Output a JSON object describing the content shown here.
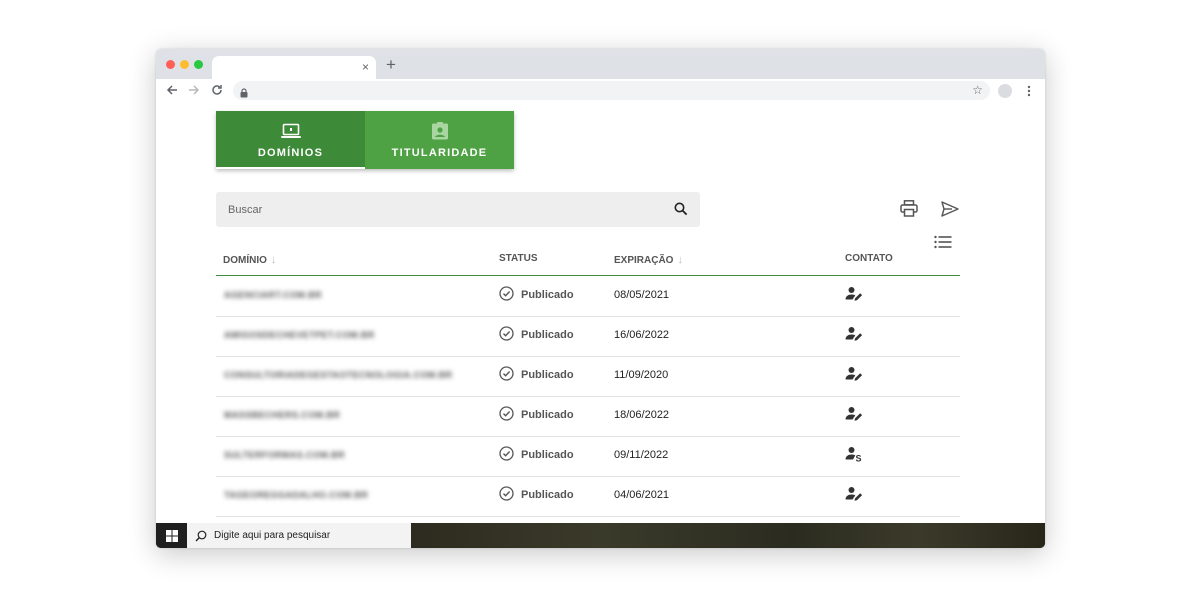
{
  "browser": {
    "tab_close": "×",
    "new_tab": "+",
    "star": "☆"
  },
  "tabs": [
    {
      "label": "DOMÍNIOS",
      "icon": "laptop-icon",
      "active": true
    },
    {
      "label": "TITULARIDADE",
      "icon": "clipboard-account-icon",
      "active": false
    }
  ],
  "search": {
    "placeholder": "Buscar"
  },
  "table": {
    "headers": {
      "domain": "DOMÍNIO",
      "status": "STATUS",
      "expiration": "EXPIRAÇÃO",
      "contact": "CONTATO"
    },
    "rows": [
      {
        "domain": "AGENCIART.COM.BR",
        "status": "Publicado",
        "expiration": "08/05/2021",
        "contact_icon": "account-edit-icon"
      },
      {
        "domain": "AMIGOSDECHEVETPET.COM.BR",
        "status": "Publicado",
        "expiration": "16/06/2022",
        "contact_icon": "account-edit-icon"
      },
      {
        "domain": "CONSULTORIADEGESTAOTECNOLOGIA.COM.BR",
        "status": "Publicado",
        "expiration": "11/09/2020",
        "contact_icon": "account-edit-icon"
      },
      {
        "domain": "MASSBECHERS.COM.BR",
        "status": "Publicado",
        "expiration": "18/06/2022",
        "contact_icon": "account-edit-icon"
      },
      {
        "domain": "SULTERFORMAS.COM.BR",
        "status": "Publicado",
        "expiration": "09/11/2022",
        "contact_icon": "account-dollar-icon"
      },
      {
        "domain": "TAGEOREGGADALHO.COM.BR",
        "status": "Publicado",
        "expiration": "04/06/2021",
        "contact_icon": "account-edit-icon"
      }
    ]
  },
  "taskbar": {
    "search_text": "Digite aqui para pesquisar"
  },
  "colors": {
    "primary_dark": "#3d8a38",
    "primary": "#4fa244"
  }
}
